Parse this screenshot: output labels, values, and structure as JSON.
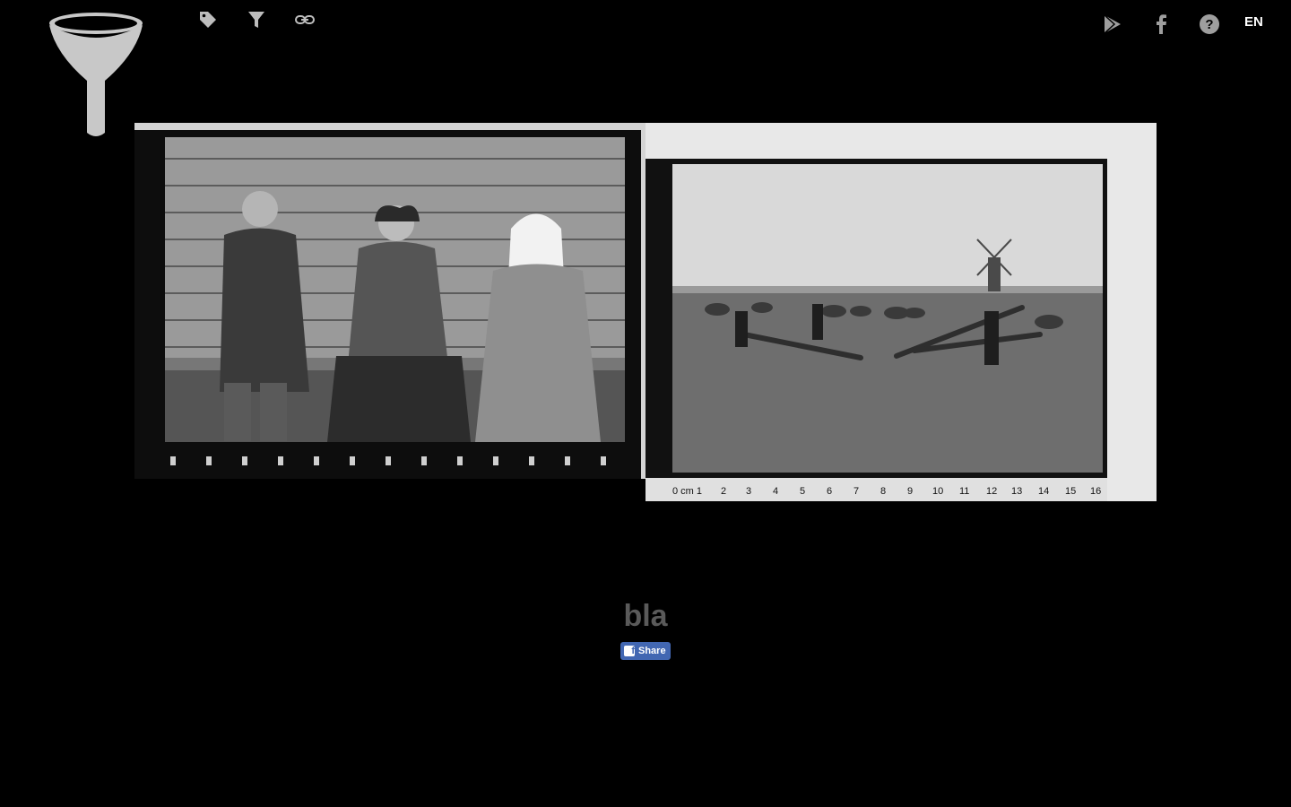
{
  "header": {
    "logo_icon": "funnel-logo-icon",
    "toolbar_icons": [
      "tag-icon",
      "filter-icon",
      "link-icon"
    ],
    "right_icons": [
      "google-play-icon",
      "facebook-icon",
      "help-icon"
    ],
    "language": "EN"
  },
  "photos": [
    {
      "name": "portrait-three-elders",
      "description_icon": "photo"
    },
    {
      "name": "field-seesaw-windmill",
      "description_icon": "photo"
    }
  ],
  "caption": {
    "text": "bla"
  },
  "share": {
    "label": "Share"
  },
  "colors": {
    "background": "#000000",
    "caption": "#5a5a5a",
    "facebook": "#4267b2"
  }
}
